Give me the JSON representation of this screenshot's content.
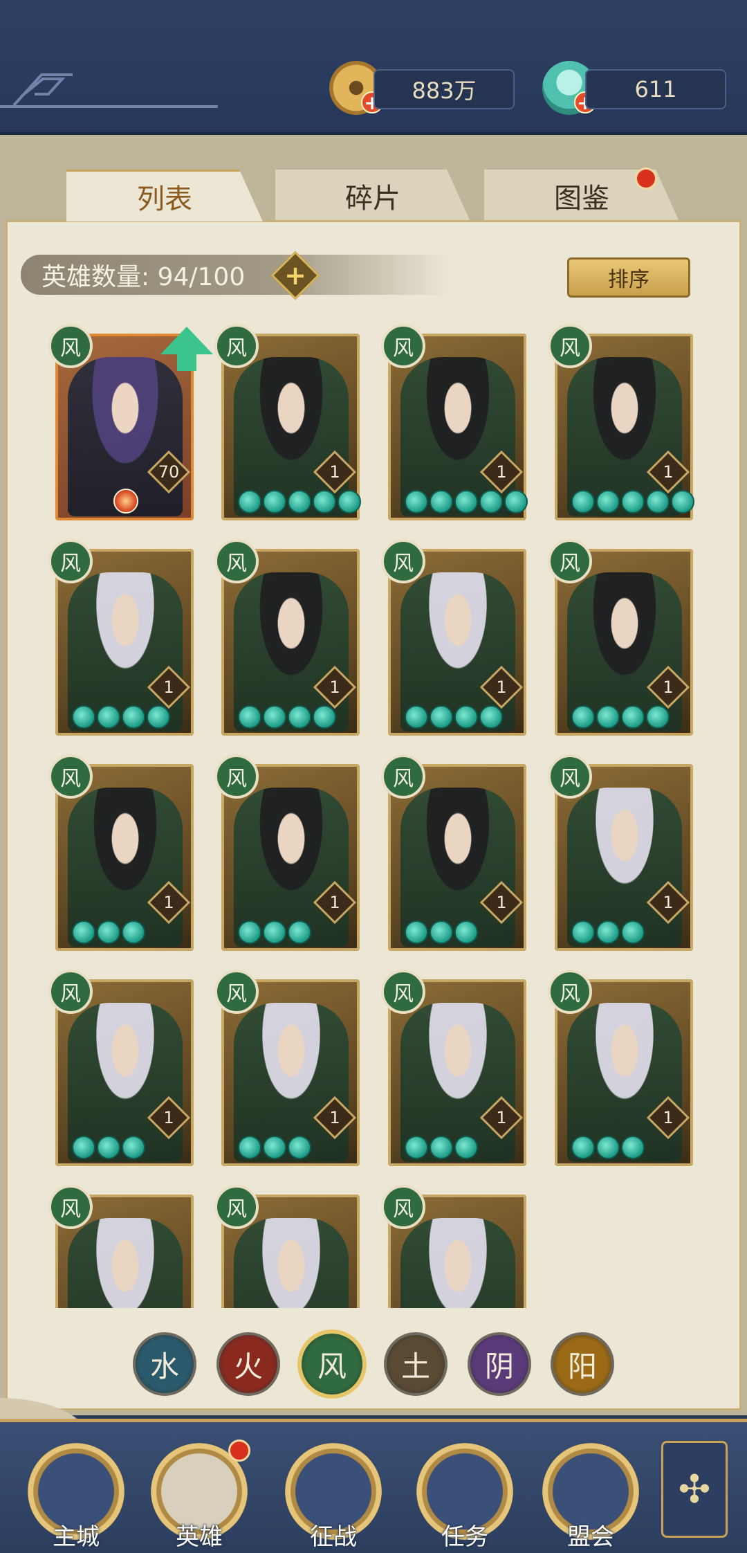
{
  "header": {
    "coins": "883万",
    "gems": "611",
    "coin_icon": "coin-icon",
    "gem_icon": "shell-gem-icon"
  },
  "tabs": [
    {
      "label": "列表",
      "active": true
    },
    {
      "label": "碎片",
      "active": false
    },
    {
      "label": "图鉴",
      "active": false,
      "notification": true
    }
  ],
  "hero_count": "英雄数量: 94/100",
  "sort_label": "排序",
  "element_glyph": "风",
  "heroes": [
    {
      "level": "70",
      "stars": 0,
      "hair": "purple",
      "upgradable": true,
      "rare": true
    },
    {
      "level": "1",
      "stars": 5,
      "hair": "black"
    },
    {
      "level": "1",
      "stars": 5,
      "hair": "black"
    },
    {
      "level": "1",
      "stars": 5,
      "hair": "black"
    },
    {
      "level": "1",
      "stars": 4,
      "hair": "white"
    },
    {
      "level": "1",
      "stars": 4,
      "hair": "black"
    },
    {
      "level": "1",
      "stars": 4,
      "hair": "white"
    },
    {
      "level": "1",
      "stars": 4,
      "hair": "black"
    },
    {
      "level": "1",
      "stars": 3,
      "hair": "black"
    },
    {
      "level": "1",
      "stars": 3,
      "hair": "black"
    },
    {
      "level": "1",
      "stars": 3,
      "hair": "black"
    },
    {
      "level": "1",
      "stars": 3,
      "hair": "white"
    },
    {
      "level": "1",
      "stars": 3,
      "hair": "white"
    },
    {
      "level": "1",
      "stars": 3,
      "hair": "white"
    },
    {
      "level": "1",
      "stars": 3,
      "hair": "white"
    },
    {
      "level": "1",
      "stars": 3,
      "hair": "white"
    },
    {
      "level": "",
      "stars": 0,
      "hair": "white"
    },
    {
      "level": "",
      "stars": 0,
      "hair": "white"
    },
    {
      "level": "",
      "stars": 0,
      "hair": "white"
    }
  ],
  "element_filters": [
    {
      "label": "水",
      "color": "#2a5a6b",
      "selected": false
    },
    {
      "label": "火",
      "color": "#8a2a1f",
      "selected": false
    },
    {
      "label": "风",
      "color": "#2f6b3e",
      "selected": true
    },
    {
      "label": "土",
      "color": "#5a4a33",
      "selected": false
    },
    {
      "label": "阴",
      "color": "#5b3a7a",
      "selected": false
    },
    {
      "label": "阳",
      "color": "#9a6a16",
      "selected": false
    }
  ],
  "nav": [
    {
      "label": "主城",
      "active": false
    },
    {
      "label": "英雄",
      "active": true,
      "notification": true
    },
    {
      "label": "征战",
      "active": false
    },
    {
      "label": "任务",
      "active": false
    },
    {
      "label": "盟会",
      "active": false
    }
  ]
}
